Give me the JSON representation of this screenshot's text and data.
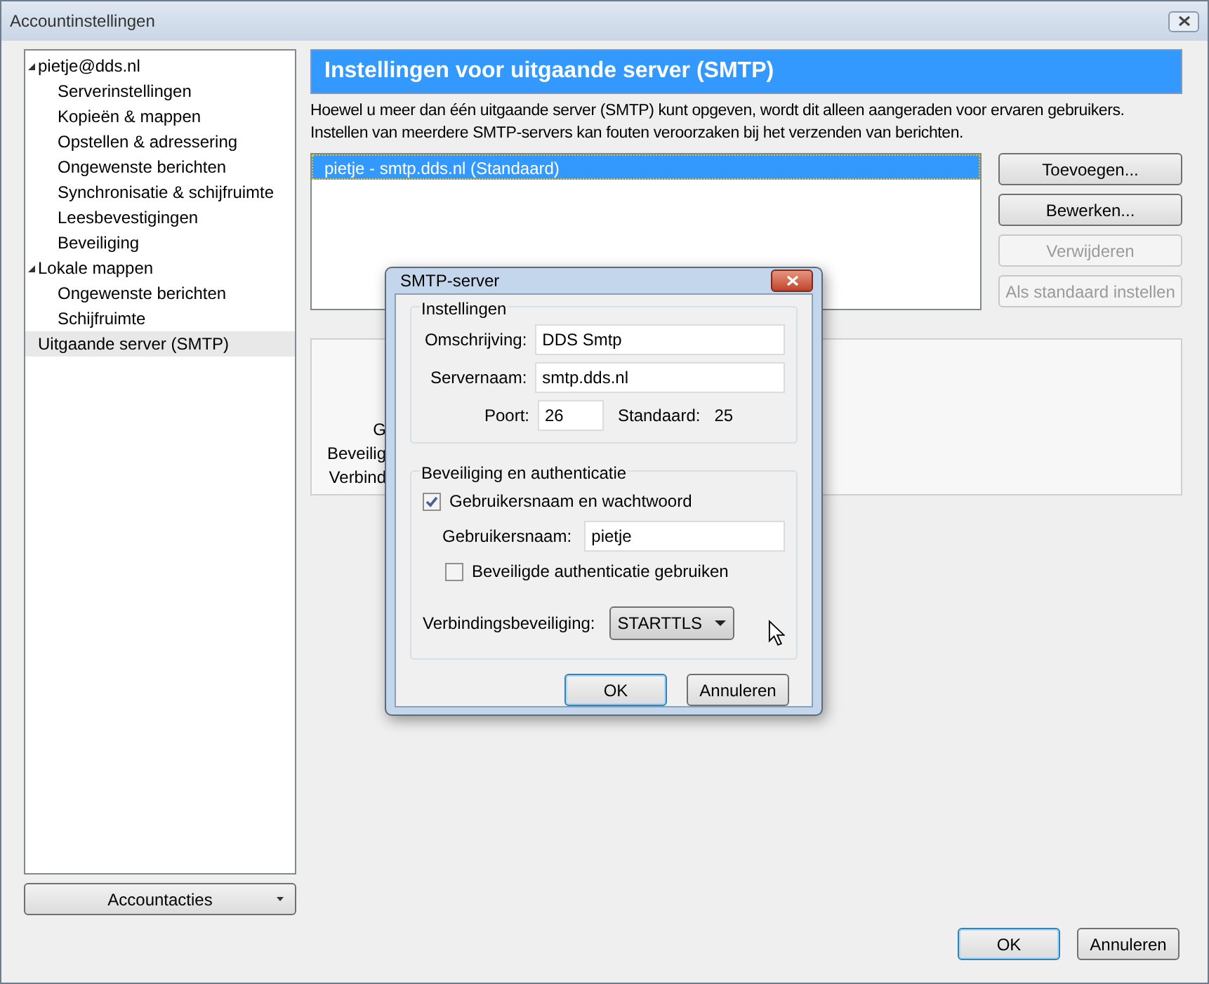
{
  "window": {
    "title": "Accountinstellingen"
  },
  "tree": [
    {
      "label": "pietje@dds.nl",
      "expanded": true,
      "selected": false,
      "children": [
        {
          "label": "Serverinstellingen",
          "selected": false
        },
        {
          "label": "Kopieën & mappen",
          "selected": false
        },
        {
          "label": "Opstellen & adressering",
          "selected": false
        },
        {
          "label": "Ongewenste berichten",
          "selected": false
        },
        {
          "label": "Synchronisatie & schijfruimte",
          "selected": false
        },
        {
          "label": "Leesbevestigingen",
          "selected": false
        },
        {
          "label": "Beveiliging",
          "selected": false
        }
      ]
    },
    {
      "label": "Lokale mappen",
      "expanded": true,
      "selected": false,
      "children": [
        {
          "label": "Ongewenste berichten",
          "selected": false
        },
        {
          "label": "Schijfruimte",
          "selected": false
        }
      ]
    },
    {
      "label": "Uitgaande server (SMTP)",
      "selected": true
    }
  ],
  "account_actions": {
    "label": "Accountacties"
  },
  "panel": {
    "heading": "Instellingen voor uitgaande server (SMTP)",
    "description": "Hoewel u meer dan één uitgaande server (SMTP) kunt opgeven, wordt dit alleen aangeraden voor ervaren gebruikers. Instellen van meerdere SMTP-servers kan fouten veroorzaken bij het verzenden van berichten.",
    "servers": [
      {
        "label": "pietje - smtp.dds.nl (Standaard)",
        "selected": true
      }
    ],
    "buttons": [
      {
        "label": "Toevoegen...",
        "disabled": false
      },
      {
        "label": "Bewerken...",
        "disabled": false
      },
      {
        "label": "Verwijderen",
        "disabled": true
      },
      {
        "label": "Als standaard instellen",
        "disabled": true
      }
    ],
    "details_labels": [
      "G",
      "Beveilig",
      "Verbind"
    ]
  },
  "dialog": {
    "title": "SMTP-server",
    "settings": {
      "legend": "Instellingen",
      "description_label": "Omschrijving:",
      "description_value": "DDS Smtp",
      "server_label": "Servernaam:",
      "server_value": "smtp.dds.nl",
      "port_label": "Poort:",
      "port_value": "26",
      "default_label": "Standaard:",
      "default_value": "25"
    },
    "security": {
      "legend": "Beveiliging en authenticatie",
      "use_password": {
        "label": "Gebruikersnaam en wachtwoord",
        "checked": true
      },
      "username_label": "Gebruikersnaam:",
      "username_value": "pietje",
      "secure_auth": {
        "label": "Beveiligde authenticatie gebruiken",
        "checked": false
      },
      "connection_label": "Verbindingsbeveiliging:",
      "connection_value": "STARTTLS"
    },
    "buttons": [
      {
        "label": "OK",
        "default": true
      },
      {
        "label": "Annuleren",
        "default": false
      }
    ]
  },
  "buttons": [
    {
      "label": "OK",
      "default": true
    },
    {
      "label": "Annuleren",
      "default": false
    }
  ]
}
